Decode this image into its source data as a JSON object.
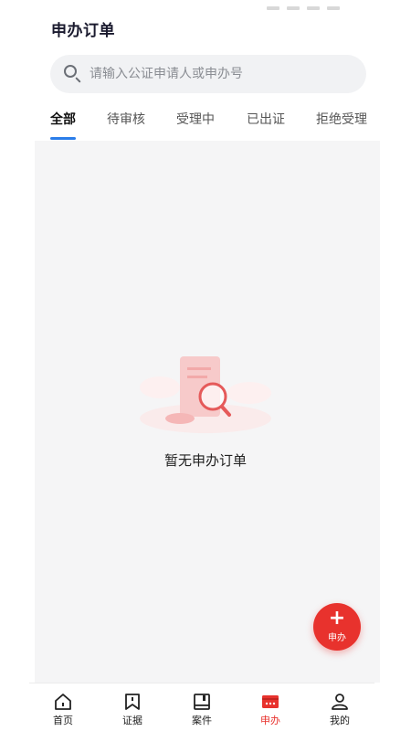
{
  "page": {
    "title": "申办订单"
  },
  "search": {
    "placeholder": "请输入公证申请人或申办号"
  },
  "tabs": [
    {
      "label": "全部",
      "active": true
    },
    {
      "label": "待审核",
      "active": false
    },
    {
      "label": "受理中",
      "active": false
    },
    {
      "label": "已出证",
      "active": false
    },
    {
      "label": "拒绝受理",
      "active": false
    }
  ],
  "empty_state": {
    "message": "暂无申办订单"
  },
  "fab": {
    "label": "申办"
  },
  "bottom_nav": [
    {
      "label": "首页",
      "icon": "home-icon",
      "active": false
    },
    {
      "label": "证据",
      "icon": "bookmark-icon",
      "active": false
    },
    {
      "label": "案件",
      "icon": "case-icon",
      "active": false
    },
    {
      "label": "申办",
      "icon": "apply-icon",
      "active": true
    },
    {
      "label": "我的",
      "icon": "profile-icon",
      "active": false
    }
  ],
  "colors": {
    "accent": "#2b7de9",
    "brand_red": "#e8322d",
    "background": "#f5f5f6"
  }
}
